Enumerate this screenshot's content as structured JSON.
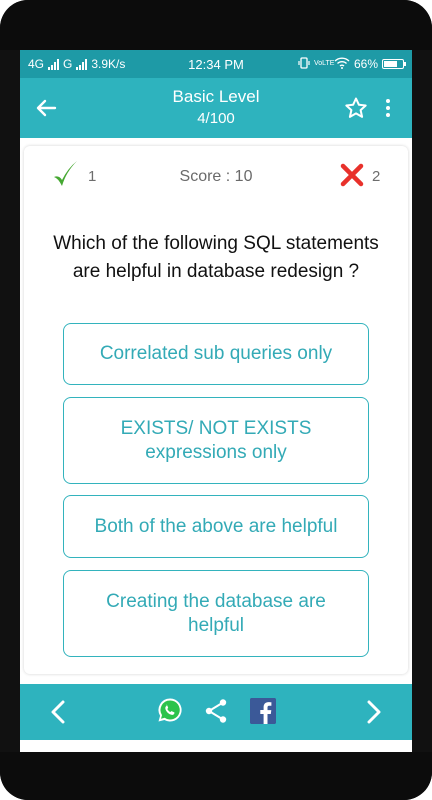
{
  "status_bar": {
    "network_left": "4G",
    "network_right": "G",
    "speed": "3.9K/s",
    "time": "12:34 PM",
    "volte": "VoLTE",
    "battery": "66%"
  },
  "app_bar": {
    "title": "Basic Level",
    "subtitle": "4/100",
    "back_icon": "arrow-left-icon",
    "star_icon": "star-outline-icon",
    "more_icon": "more-vertical-icon"
  },
  "score": {
    "correct_count": "1",
    "score_label": "Score : 10",
    "wrong_count": "2"
  },
  "question": {
    "text": "Which of the following SQL statements are helpful in database redesign ?"
  },
  "options": [
    {
      "label": "Correlated sub queries only"
    },
    {
      "label": "EXISTS/ NOT EXISTS expressions only"
    },
    {
      "label": "Both of the above are helpful"
    },
    {
      "label": "Creating the database are helpful"
    }
  ],
  "bottom_bar": {
    "prev_icon": "chevron-left-icon",
    "whatsapp_icon": "whatsapp-icon",
    "share_icon": "share-icon",
    "facebook_icon": "facebook-icon",
    "next_icon": "chevron-right-icon"
  },
  "colors": {
    "primary": "#2eb3be",
    "status_bar": "#1e9aa6",
    "option_border": "#33b3bd",
    "option_text": "#33aab6",
    "correct_green": "#46a832",
    "wrong_red": "#e8312b"
  }
}
